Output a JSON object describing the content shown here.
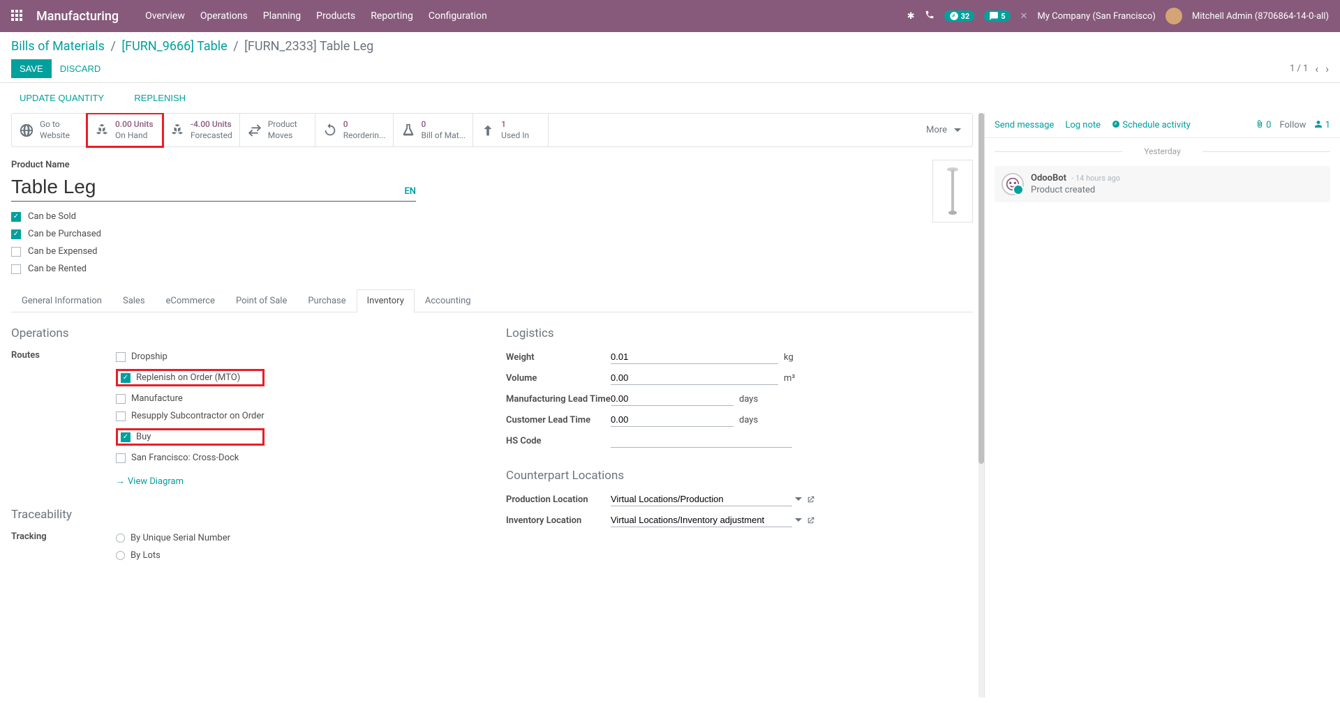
{
  "navbar": {
    "brand": "Manufacturing",
    "menu": [
      "Overview",
      "Operations",
      "Planning",
      "Products",
      "Reporting",
      "Configuration"
    ],
    "badge_clock": "32",
    "badge_chat": "5",
    "company": "My Company (San Francisco)",
    "user": "Mitchell Admin (8706864-14-0-all)"
  },
  "breadcrumb": {
    "root": "Bills of Materials",
    "parent": "[FURN_9666] Table",
    "current": "[FURN_2333] Table Leg"
  },
  "buttons": {
    "save": "SAVE",
    "discard": "DISCARD"
  },
  "pager": {
    "text": "1 / 1"
  },
  "actions": {
    "update_qty": "UPDATE QUANTITY",
    "replenish": "REPLENISH"
  },
  "stats": {
    "website": {
      "line1": "Go to",
      "line2": "Website"
    },
    "onhand": {
      "value": "0.00 Units",
      "label": "On Hand"
    },
    "forecast": {
      "value": "-4.00 Units",
      "label": "Forecasted"
    },
    "moves": {
      "line1": "Product",
      "line2": "Moves"
    },
    "reorder": {
      "value": "0",
      "label": "Reorderin..."
    },
    "bom": {
      "value": "0",
      "label": "Bill of Mat..."
    },
    "usedin": {
      "value": "1",
      "label": "Used In"
    },
    "more": "More"
  },
  "form": {
    "product_name_label": "Product Name",
    "product_name": "Table Leg",
    "lang": "EN",
    "checks": {
      "sold": "Can be Sold",
      "purchased": "Can be Purchased",
      "expensed": "Can be Expensed",
      "rented": "Can be Rented"
    }
  },
  "tabs": [
    "General Information",
    "Sales",
    "eCommerce",
    "Point of Sale",
    "Purchase",
    "Inventory",
    "Accounting"
  ],
  "inventory": {
    "operations_title": "Operations",
    "routes_label": "Routes",
    "routes": {
      "dropship": "Dropship",
      "mto": "Replenish on Order (MTO)",
      "manufacture": "Manufacture",
      "resupply": "Resupply Subcontractor on Order",
      "buy": "Buy",
      "crossdock": "San Francisco: Cross-Dock"
    },
    "view_diagram": "View Diagram",
    "logistics_title": "Logistics",
    "weight_label": "Weight",
    "weight_value": "0.01",
    "weight_unit": "kg",
    "volume_label": "Volume",
    "volume_value": "0.00",
    "volume_unit": "m³",
    "mlt_label": "Manufacturing Lead Time",
    "mlt_value": "0.00",
    "mlt_unit": "days",
    "clt_label": "Customer Lead Time",
    "clt_value": "0.00",
    "clt_unit": "days",
    "hs_label": "HS Code",
    "hs_value": "",
    "traceability_title": "Traceability",
    "tracking_label": "Tracking",
    "tracking_serial": "By Unique Serial Number",
    "tracking_lots": "By Lots",
    "counterpart_title": "Counterpart Locations",
    "prod_loc_label": "Production Location",
    "prod_loc_value": "Virtual Locations/Production",
    "inv_loc_label": "Inventory Location",
    "inv_loc_value": "Virtual Locations/Inventory adjustment"
  },
  "chatter": {
    "send": "Send message",
    "log": "Log note",
    "schedule": "Schedule activity",
    "attach_count": "0",
    "follow": "Follow",
    "follower_count": "1",
    "sep": "Yesterday",
    "msg_author": "OdooBot",
    "msg_time": "- 14 hours ago",
    "msg_body": "Product created"
  }
}
